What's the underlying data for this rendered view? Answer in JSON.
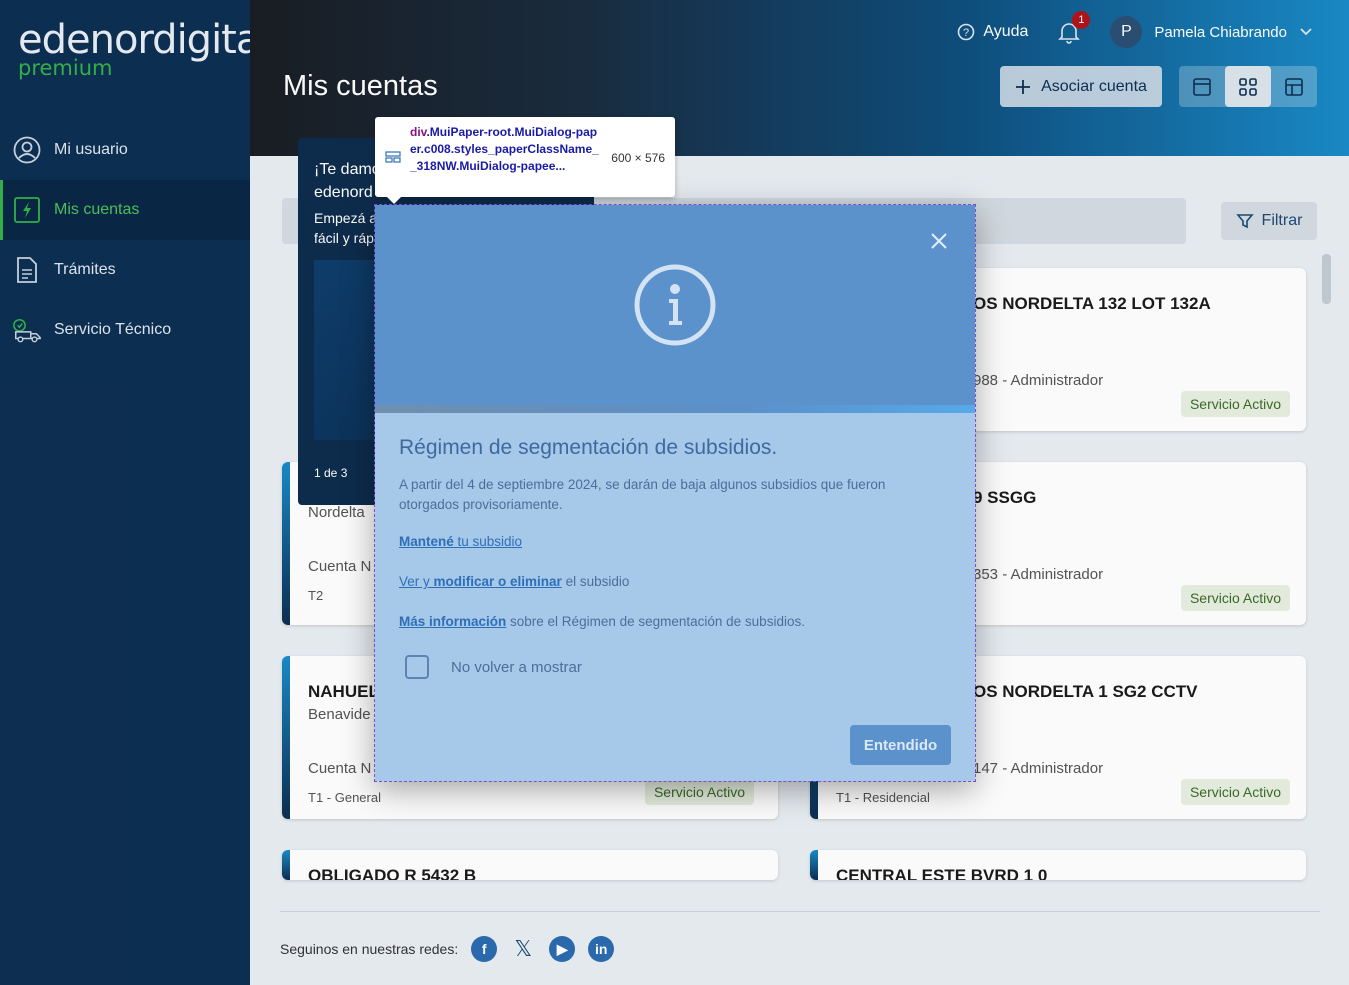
{
  "brand": {
    "name": "edenordigital",
    "tier": "premium"
  },
  "sidebar": {
    "items": [
      {
        "label": "Mi usuario",
        "icon": "user-icon"
      },
      {
        "label": "Mis cuentas",
        "icon": "bolt-icon",
        "active": true
      },
      {
        "label": "Trámites",
        "icon": "document-icon"
      },
      {
        "label": "Servicio Técnico",
        "icon": "truck-icon"
      }
    ]
  },
  "header": {
    "title": "Mis cuentas",
    "help_label": "Ayuda",
    "notifications_count": "1",
    "user_initial": "P",
    "user_name": "Pamela Chiabrando",
    "asociar_label": "Asociar cuenta",
    "filter_label": "Filtrar"
  },
  "promo": {
    "line1": "¡Te damo",
    "line2": "edenord",
    "text1": "Empezá a",
    "text2": "fácil y ráp",
    "pager": "1 de 3"
  },
  "cards": [
    {
      "title": "OS NORDELTA 132 LOT 132A",
      "sub": "",
      "acct": "988 - Administrador",
      "tarifa": "",
      "status": "Servicio Activo"
    },
    {
      "title": "",
      "sub": "Nordelta",
      "acct": "Cuenta N",
      "tarifa": "T2",
      "status": ""
    },
    {
      "title": "9 SSGG",
      "sub": "",
      "acct": "353 - Administrador",
      "tarifa": "",
      "status": "Servicio Activo"
    },
    {
      "title": "NAHUEL",
      "sub": "Benavide",
      "acct": "Cuenta N",
      "tarifa": "T1 - General",
      "status": "Servicio Activo"
    },
    {
      "title": "OS NORDELTA 1 SG2 CCTV",
      "sub": "",
      "acct": "147 - Administrador",
      "tarifa": "T1 - Residencial",
      "status": "Servicio Activo"
    },
    {
      "title": "OBLIGADO R 5432 B",
      "sub": "",
      "acct": "",
      "tarifa": "",
      "status": ""
    },
    {
      "title": "CENTRAL ESTE BVRD 1 0",
      "sub": "",
      "acct": "",
      "tarifa": "",
      "status": ""
    }
  ],
  "footer": {
    "social_label": "Seguinos en nuestras redes:"
  },
  "dialog": {
    "title": "Régimen de segmentación de subsidios.",
    "text": "A partir del 4 de septiembre 2024, se darán de baja algunos subsidios que fueron otorgados provisoriamente.",
    "link1_bold": "Mantené",
    "link1_rest": " tu subsidio",
    "link2_a": "Ver y ",
    "link2_b": "modificar o eliminar",
    "link2_tail": " el subsidio",
    "link3_bold": "Más información",
    "link3_tail": " sobre el Régimen de segmentación de subsidios.",
    "checkbox_label": "No volver a mostrar",
    "ok_label": "Entendido"
  },
  "devtools": {
    "tag": "div",
    "selector": ".MuiPaper-root.MuiDialog-paper.c008.styles_paperClassName__318NW.MuiDialog-pape​e...",
    "size": "600 × 576"
  }
}
